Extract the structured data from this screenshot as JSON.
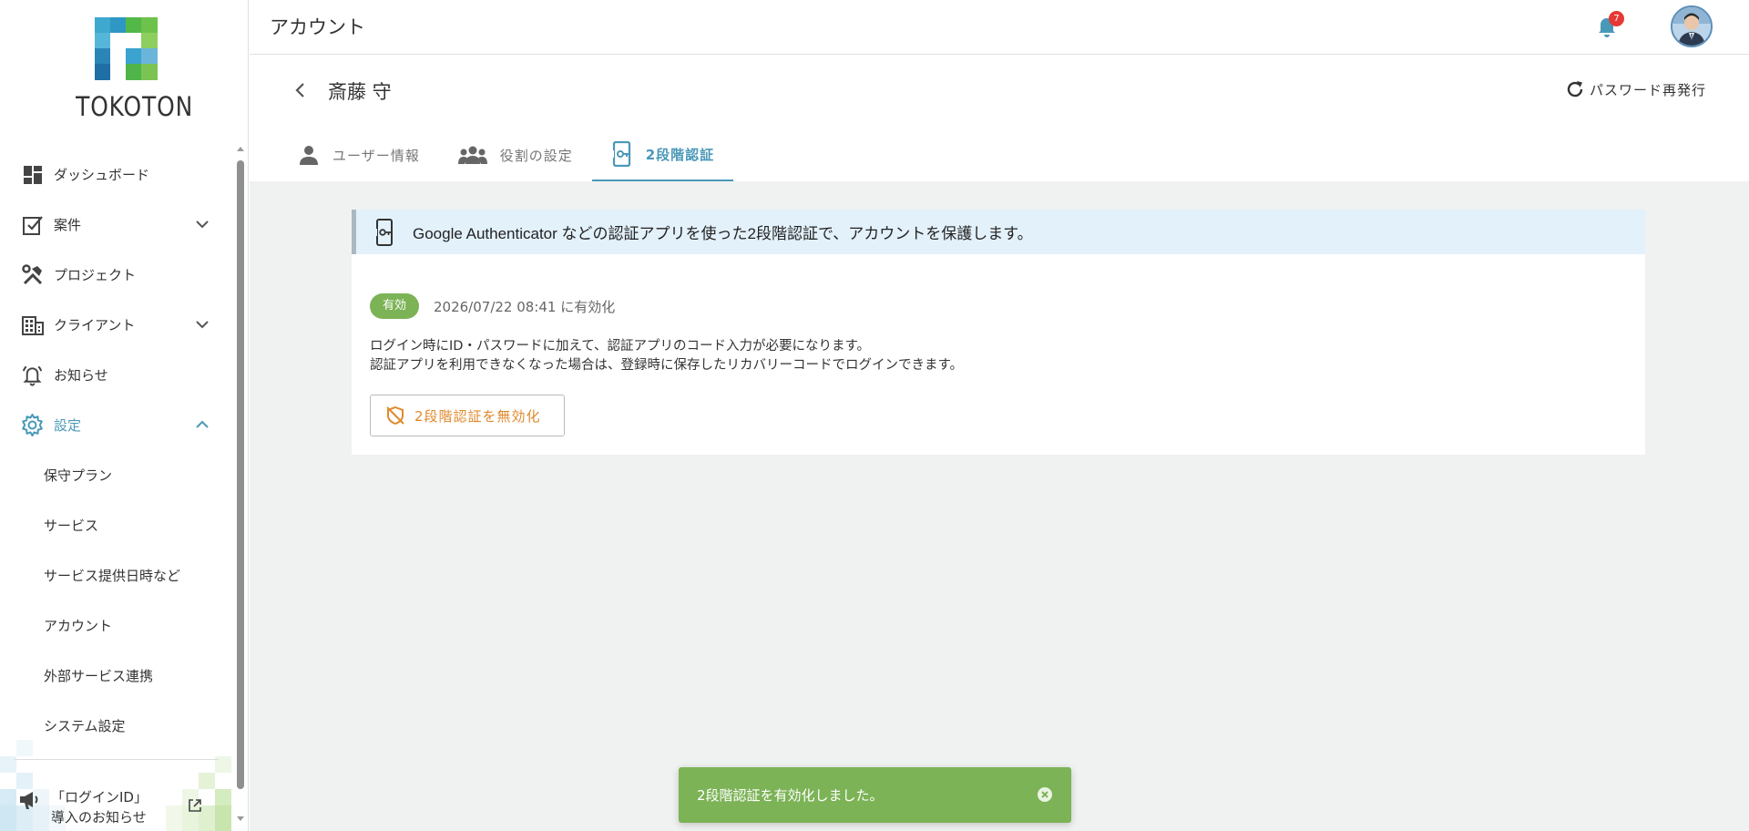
{
  "brand": {
    "logo_text": "TOKOTON"
  },
  "header": {
    "title": "アカウント",
    "notification_count": "7"
  },
  "sidebar": {
    "items": [
      {
        "label": "ダッシュボード",
        "icon": "dashboard-icon"
      },
      {
        "label": "案件",
        "icon": "task-check-icon"
      },
      {
        "label": "プロジェクト",
        "icon": "tools-icon"
      },
      {
        "label": "クライアント",
        "icon": "building-icon"
      },
      {
        "label": "お知らせ",
        "icon": "bell-ring-icon"
      },
      {
        "label": "設定",
        "icon": "gear-icon"
      }
    ],
    "settings_sub": [
      "保守プラン",
      "サービス",
      "サービス提供日時など",
      "アカウント",
      "外部サービス連携",
      "システム設定"
    ],
    "notice_line1": "「ログインID」",
    "notice_line2": "導入のお知らせ"
  },
  "page": {
    "user_name": "斎藤 守",
    "reissue_label": "パスワード再発行",
    "tabs": [
      {
        "label": "ユーザー情報"
      },
      {
        "label": "役割の設定"
      },
      {
        "label": "2段階認証"
      }
    ]
  },
  "two_factor": {
    "banner": "Google Authenticator などの認証アプリを使った2段階認証で、アカウントを保護します。",
    "status_badge": "有効",
    "status_time": "2026/07/22 08:41 に有効化",
    "desc_line1": "ログイン時にID・パスワードに加えて、認証アプリのコード入力が必要になります。",
    "desc_line2": "認証アプリを利用できなくなった場合は、登録時に保存したリカバリーコードでログインできます。",
    "disable_label": "2段階認証を無効化"
  },
  "toast": {
    "message": "2段階認証を有効化しました。"
  },
  "colors": {
    "accent": "#4a98b8",
    "success": "#7cb356",
    "warning": "#e0892c",
    "badge": "#e53935"
  }
}
